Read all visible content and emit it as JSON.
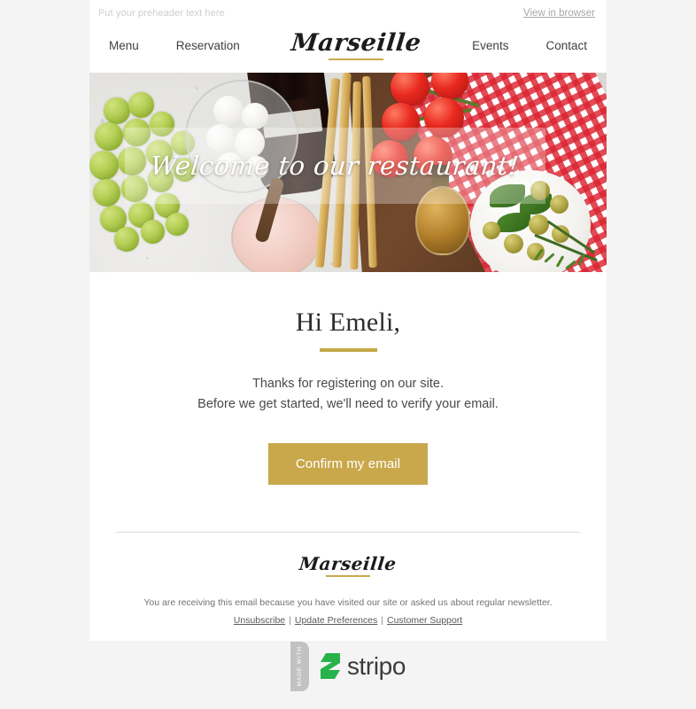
{
  "colors": {
    "page_background": "#f4f4f4",
    "email_background": "#ffffff",
    "accent_gold": "#c9a84c",
    "rule_gold": "#c4a747",
    "cta_background": "#c9a84c",
    "cta_text": "#ffffff",
    "stripo_green": "#28b24b"
  },
  "preheader": {
    "text": "Put your preheader text here",
    "view_in_browser": "View in browser"
  },
  "nav": {
    "left_items": [
      {
        "label": "Menu"
      },
      {
        "label": "Reservation"
      }
    ],
    "right_items": [
      {
        "label": "Events"
      },
      {
        "label": "Contact"
      }
    ],
    "logo": "Marseille"
  },
  "hero": {
    "title": "Welcome to our restaurant!",
    "image_alt": "Overhead food flat lay with green grapes, mozzarella in a glass bowl, wine bottle, pink salt, breadsticks, cherry tomatoes on the vine, olive oil cruet, olives with basil, red checkered cloth and rosemary"
  },
  "main": {
    "greeting": "Hi Emeli,",
    "paragraph_line1": "Thanks for registering on our site.",
    "paragraph_line2": "Before we get started, we'll need to verify your email.",
    "cta_label": "Confirm my email"
  },
  "footer": {
    "logo": "Marseille",
    "note": "You are receiving this email because you have visited our site or asked us about regular newsletter.",
    "links": [
      {
        "label": "Unsubscribe"
      },
      {
        "label": "Update Preferences"
      },
      {
        "label": "Customer Support"
      }
    ],
    "separator": "|"
  },
  "badge": {
    "ribbon_text": "MADE WITH",
    "brand": "stripo"
  }
}
